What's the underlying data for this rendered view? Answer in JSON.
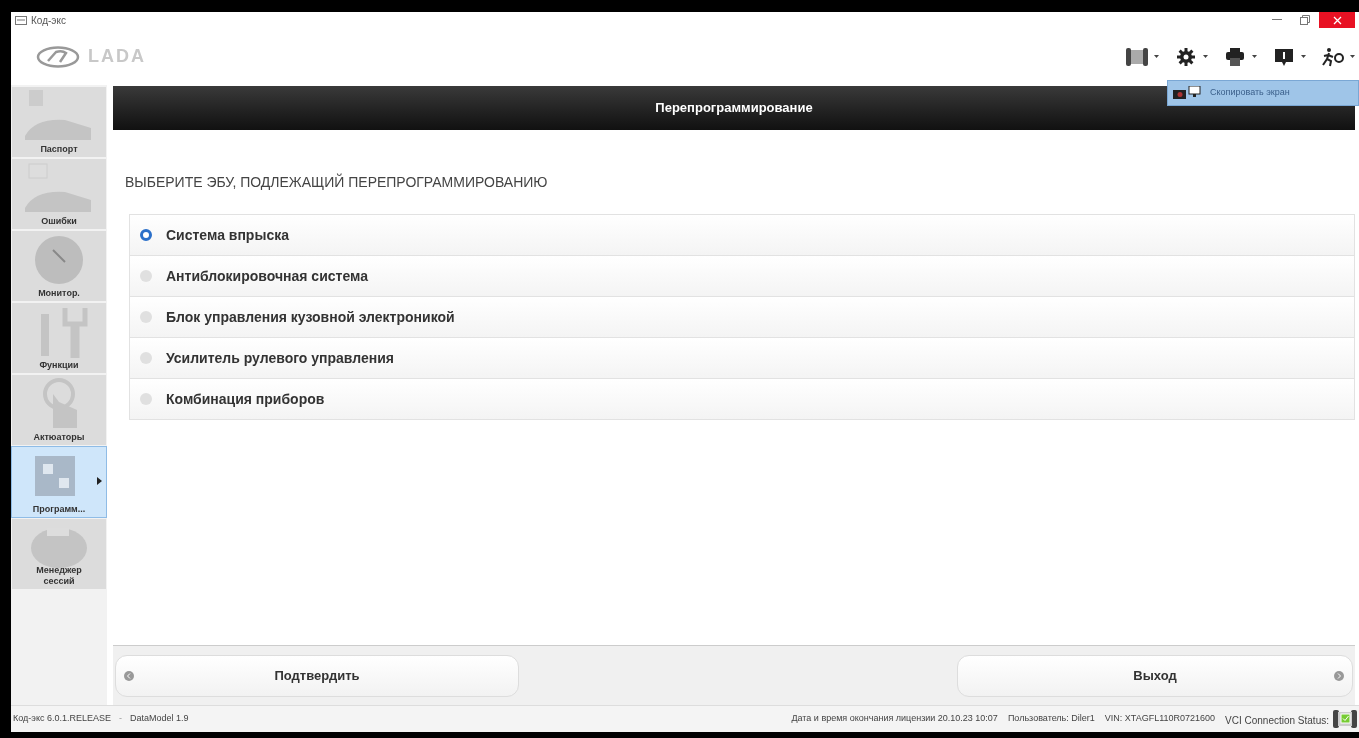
{
  "window": {
    "title": "Код-экс"
  },
  "header": {
    "logo_text": "LADA",
    "toolbar": [
      {
        "kind": "vci"
      },
      {
        "kind": "settings"
      },
      {
        "kind": "printer"
      },
      {
        "kind": "info"
      },
      {
        "kind": "exit"
      }
    ]
  },
  "dropdown_menu": {
    "items": [
      "Скопировать экран"
    ]
  },
  "sidebar": {
    "items": [
      {
        "label": "Паспорт",
        "kind": "passport",
        "selected": false
      },
      {
        "label": "Ошибки",
        "kind": "errors",
        "selected": false
      },
      {
        "label": "Монитор.",
        "kind": "monitor",
        "selected": false
      },
      {
        "label": "Функции",
        "kind": "functions",
        "selected": false
      },
      {
        "label": "Актюаторы",
        "kind": "actuators",
        "selected": false
      },
      {
        "label": "Программ...",
        "kind": "programming",
        "selected": true
      },
      {
        "label": "Менеджер сессий",
        "kind": "sessions",
        "selected": false
      }
    ]
  },
  "panel": {
    "title": "Перепрограммирование",
    "heading": "ВЫБЕРИТЕ ЭБУ, ПОДЛЕЖАЩИЙ ПЕРЕПРОГРАММИРОВАНИЮ",
    "options": [
      {
        "label": "Система впрыска",
        "selected": true
      },
      {
        "label": "Антиблокировочная система",
        "selected": false
      },
      {
        "label": "Блок управления кузовной электроникой",
        "selected": false
      },
      {
        "label": "Усилитель рулевого управления",
        "selected": false
      },
      {
        "label": "Комбинация приборов",
        "selected": false
      }
    ]
  },
  "buttons": [
    {
      "label": "Подтвердить",
      "kind": "back"
    },
    {
      "label": "Выход",
      "kind": "forward"
    }
  ],
  "status_bar": {
    "version": "Код-экс 6.0.1.RELEASE",
    "separator": "-",
    "data_model": "DataModel 1.9",
    "license": "Дата и время окончания лицензии 20.10.23 10:07",
    "user": "Пользователь: Diler1",
    "vin": "VIN: XTAGFL110R0721600",
    "vci_label": "VCI Connection Status:"
  }
}
